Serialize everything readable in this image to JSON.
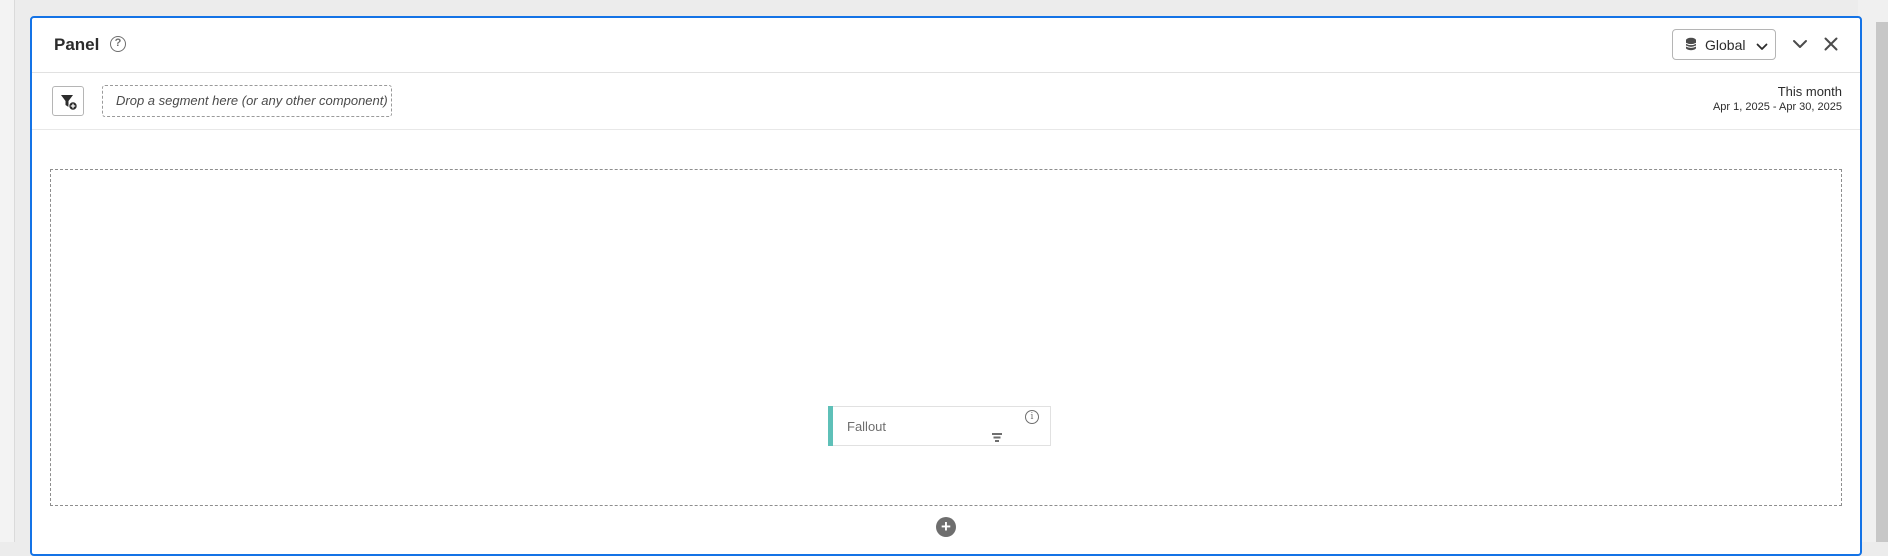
{
  "panel": {
    "title": "Panel",
    "help_icon": "?",
    "global_button": {
      "label": "Global",
      "icon": "database-icon"
    }
  },
  "segment_bar": {
    "drop_zone_text": "Drop a segment here (or any other component)",
    "date_range": {
      "label": "This month",
      "dates": "Apr 1, 2025 - Apr 30, 2025"
    }
  },
  "canvas": {
    "visualization_card": {
      "label": "Fallout",
      "info_icon": "i",
      "accent_color": "#5ec0b8"
    }
  },
  "add_visualization": "+",
  "colors": {
    "panel_border": "#1473e6",
    "accent": "#5ec0b8"
  }
}
